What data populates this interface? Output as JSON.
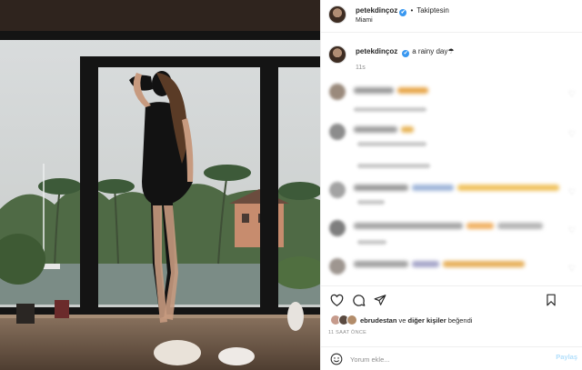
{
  "post": {
    "username": "petekdinçoz",
    "follow_state": "Takiptesin",
    "location": "Miami",
    "verified_glyph": "✔",
    "bullet": "•"
  },
  "caption": {
    "username": "petekdinçoz",
    "text": "a rainy day☂",
    "time": "11s"
  },
  "comments_blurred": true,
  "likes": {
    "user": "ebrudestan",
    "connector": "ve",
    "others": "diğer kişiler",
    "verb": "beğendi"
  },
  "timestamp": "11 SAAT ÖNCE",
  "composer": {
    "placeholder": "Yorum ekle...",
    "post_label": "Paylaş"
  },
  "icons": {
    "like": "heart-icon",
    "comment": "comment-icon",
    "share": "share-icon",
    "save": "bookmark-icon",
    "emoji": "smiley-icon"
  },
  "colors": {
    "verified": "#3897f0",
    "secondary_text": "#8e8e8e",
    "post_button_disabled": "#b2dffc",
    "divider": "#efefef"
  }
}
